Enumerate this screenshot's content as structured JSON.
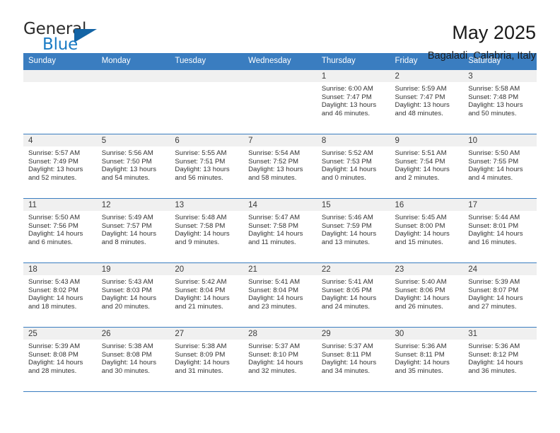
{
  "brand": {
    "name_part1": "General",
    "name_part2": "Blue",
    "triangle_color": "#1464a5",
    "blue_color": "#1a7bc4"
  },
  "header": {
    "title": "May 2025",
    "subtitle": "Bagaladi, Calabria, Italy"
  },
  "theme": {
    "header_blue": "#3a7dc0",
    "daynum_bg": "#f0f0f0"
  },
  "weekday_headers": [
    "Sunday",
    "Monday",
    "Tuesday",
    "Wednesday",
    "Thursday",
    "Friday",
    "Saturday"
  ],
  "labels": {
    "sunrise_prefix": "Sunrise: ",
    "sunset_prefix": "Sunset: ",
    "daylight_prefix": "Daylight: "
  },
  "weeks": [
    [
      {
        "day": "",
        "sunrise": "",
        "sunset": "",
        "daylight": "",
        "empty": true
      },
      {
        "day": "",
        "sunrise": "",
        "sunset": "",
        "daylight": "",
        "empty": true
      },
      {
        "day": "",
        "sunrise": "",
        "sunset": "",
        "daylight": "",
        "empty": true
      },
      {
        "day": "",
        "sunrise": "",
        "sunset": "",
        "daylight": "",
        "empty": true
      },
      {
        "day": "1",
        "sunrise": "Sunrise: 6:00 AM",
        "sunset": "Sunset: 7:47 PM",
        "daylight": "Daylight: 13 hours and 46 minutes."
      },
      {
        "day": "2",
        "sunrise": "Sunrise: 5:59 AM",
        "sunset": "Sunset: 7:47 PM",
        "daylight": "Daylight: 13 hours and 48 minutes."
      },
      {
        "day": "3",
        "sunrise": "Sunrise: 5:58 AM",
        "sunset": "Sunset: 7:48 PM",
        "daylight": "Daylight: 13 hours and 50 minutes."
      }
    ],
    [
      {
        "day": "4",
        "sunrise": "Sunrise: 5:57 AM",
        "sunset": "Sunset: 7:49 PM",
        "daylight": "Daylight: 13 hours and 52 minutes."
      },
      {
        "day": "5",
        "sunrise": "Sunrise: 5:56 AM",
        "sunset": "Sunset: 7:50 PM",
        "daylight": "Daylight: 13 hours and 54 minutes."
      },
      {
        "day": "6",
        "sunrise": "Sunrise: 5:55 AM",
        "sunset": "Sunset: 7:51 PM",
        "daylight": "Daylight: 13 hours and 56 minutes."
      },
      {
        "day": "7",
        "sunrise": "Sunrise: 5:54 AM",
        "sunset": "Sunset: 7:52 PM",
        "daylight": "Daylight: 13 hours and 58 minutes."
      },
      {
        "day": "8",
        "sunrise": "Sunrise: 5:52 AM",
        "sunset": "Sunset: 7:53 PM",
        "daylight": "Daylight: 14 hours and 0 minutes."
      },
      {
        "day": "9",
        "sunrise": "Sunrise: 5:51 AM",
        "sunset": "Sunset: 7:54 PM",
        "daylight": "Daylight: 14 hours and 2 minutes."
      },
      {
        "day": "10",
        "sunrise": "Sunrise: 5:50 AM",
        "sunset": "Sunset: 7:55 PM",
        "daylight": "Daylight: 14 hours and 4 minutes."
      }
    ],
    [
      {
        "day": "11",
        "sunrise": "Sunrise: 5:50 AM",
        "sunset": "Sunset: 7:56 PM",
        "daylight": "Daylight: 14 hours and 6 minutes."
      },
      {
        "day": "12",
        "sunrise": "Sunrise: 5:49 AM",
        "sunset": "Sunset: 7:57 PM",
        "daylight": "Daylight: 14 hours and 8 minutes."
      },
      {
        "day": "13",
        "sunrise": "Sunrise: 5:48 AM",
        "sunset": "Sunset: 7:58 PM",
        "daylight": "Daylight: 14 hours and 9 minutes."
      },
      {
        "day": "14",
        "sunrise": "Sunrise: 5:47 AM",
        "sunset": "Sunset: 7:58 PM",
        "daylight": "Daylight: 14 hours and 11 minutes."
      },
      {
        "day": "15",
        "sunrise": "Sunrise: 5:46 AM",
        "sunset": "Sunset: 7:59 PM",
        "daylight": "Daylight: 14 hours and 13 minutes."
      },
      {
        "day": "16",
        "sunrise": "Sunrise: 5:45 AM",
        "sunset": "Sunset: 8:00 PM",
        "daylight": "Daylight: 14 hours and 15 minutes."
      },
      {
        "day": "17",
        "sunrise": "Sunrise: 5:44 AM",
        "sunset": "Sunset: 8:01 PM",
        "daylight": "Daylight: 14 hours and 16 minutes."
      }
    ],
    [
      {
        "day": "18",
        "sunrise": "Sunrise: 5:43 AM",
        "sunset": "Sunset: 8:02 PM",
        "daylight": "Daylight: 14 hours and 18 minutes."
      },
      {
        "day": "19",
        "sunrise": "Sunrise: 5:43 AM",
        "sunset": "Sunset: 8:03 PM",
        "daylight": "Daylight: 14 hours and 20 minutes."
      },
      {
        "day": "20",
        "sunrise": "Sunrise: 5:42 AM",
        "sunset": "Sunset: 8:04 PM",
        "daylight": "Daylight: 14 hours and 21 minutes."
      },
      {
        "day": "21",
        "sunrise": "Sunrise: 5:41 AM",
        "sunset": "Sunset: 8:04 PM",
        "daylight": "Daylight: 14 hours and 23 minutes."
      },
      {
        "day": "22",
        "sunrise": "Sunrise: 5:41 AM",
        "sunset": "Sunset: 8:05 PM",
        "daylight": "Daylight: 14 hours and 24 minutes."
      },
      {
        "day": "23",
        "sunrise": "Sunrise: 5:40 AM",
        "sunset": "Sunset: 8:06 PM",
        "daylight": "Daylight: 14 hours and 26 minutes."
      },
      {
        "day": "24",
        "sunrise": "Sunrise: 5:39 AM",
        "sunset": "Sunset: 8:07 PM",
        "daylight": "Daylight: 14 hours and 27 minutes."
      }
    ],
    [
      {
        "day": "25",
        "sunrise": "Sunrise: 5:39 AM",
        "sunset": "Sunset: 8:08 PM",
        "daylight": "Daylight: 14 hours and 28 minutes."
      },
      {
        "day": "26",
        "sunrise": "Sunrise: 5:38 AM",
        "sunset": "Sunset: 8:08 PM",
        "daylight": "Daylight: 14 hours and 30 minutes."
      },
      {
        "day": "27",
        "sunrise": "Sunrise: 5:38 AM",
        "sunset": "Sunset: 8:09 PM",
        "daylight": "Daylight: 14 hours and 31 minutes."
      },
      {
        "day": "28",
        "sunrise": "Sunrise: 5:37 AM",
        "sunset": "Sunset: 8:10 PM",
        "daylight": "Daylight: 14 hours and 32 minutes."
      },
      {
        "day": "29",
        "sunrise": "Sunrise: 5:37 AM",
        "sunset": "Sunset: 8:11 PM",
        "daylight": "Daylight: 14 hours and 34 minutes."
      },
      {
        "day": "30",
        "sunrise": "Sunrise: 5:36 AM",
        "sunset": "Sunset: 8:11 PM",
        "daylight": "Daylight: 14 hours and 35 minutes."
      },
      {
        "day": "31",
        "sunrise": "Sunrise: 5:36 AM",
        "sunset": "Sunset: 8:12 PM",
        "daylight": "Daylight: 14 hours and 36 minutes."
      }
    ]
  ]
}
